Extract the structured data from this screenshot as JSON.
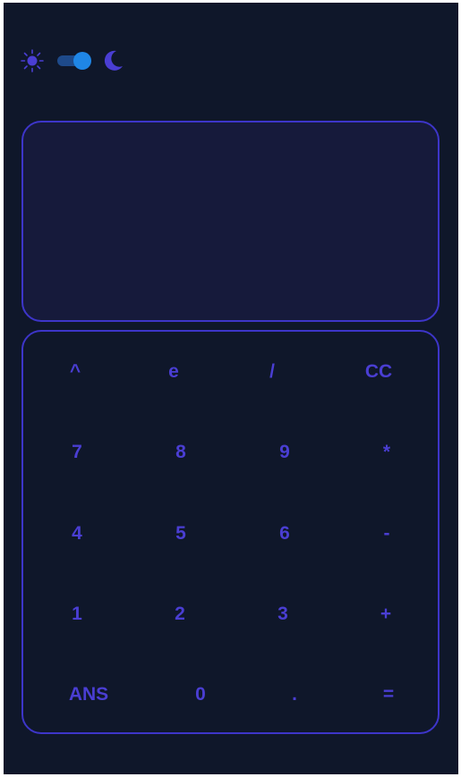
{
  "theme": {
    "light_icon": "sun-icon",
    "dark_icon": "moon-icon",
    "mode": "dark",
    "toggle_on": true
  },
  "display": {
    "value": ""
  },
  "keypad": {
    "rows": [
      [
        "^",
        "e",
        "/",
        "CC"
      ],
      [
        "7",
        "8",
        "9",
        "*"
      ],
      [
        "4",
        "5",
        "6",
        "-"
      ],
      [
        "1",
        "2",
        "3",
        "+"
      ],
      [
        "ANS",
        "0",
        ".",
        "="
      ]
    ]
  },
  "colors": {
    "background": "#0f172a",
    "display_background": "#161a3b",
    "border": "#3d35c9",
    "key_text": "#4a3ed3",
    "toggle_knob": "#1f86e6",
    "toggle_track": "#1e4a8a"
  }
}
